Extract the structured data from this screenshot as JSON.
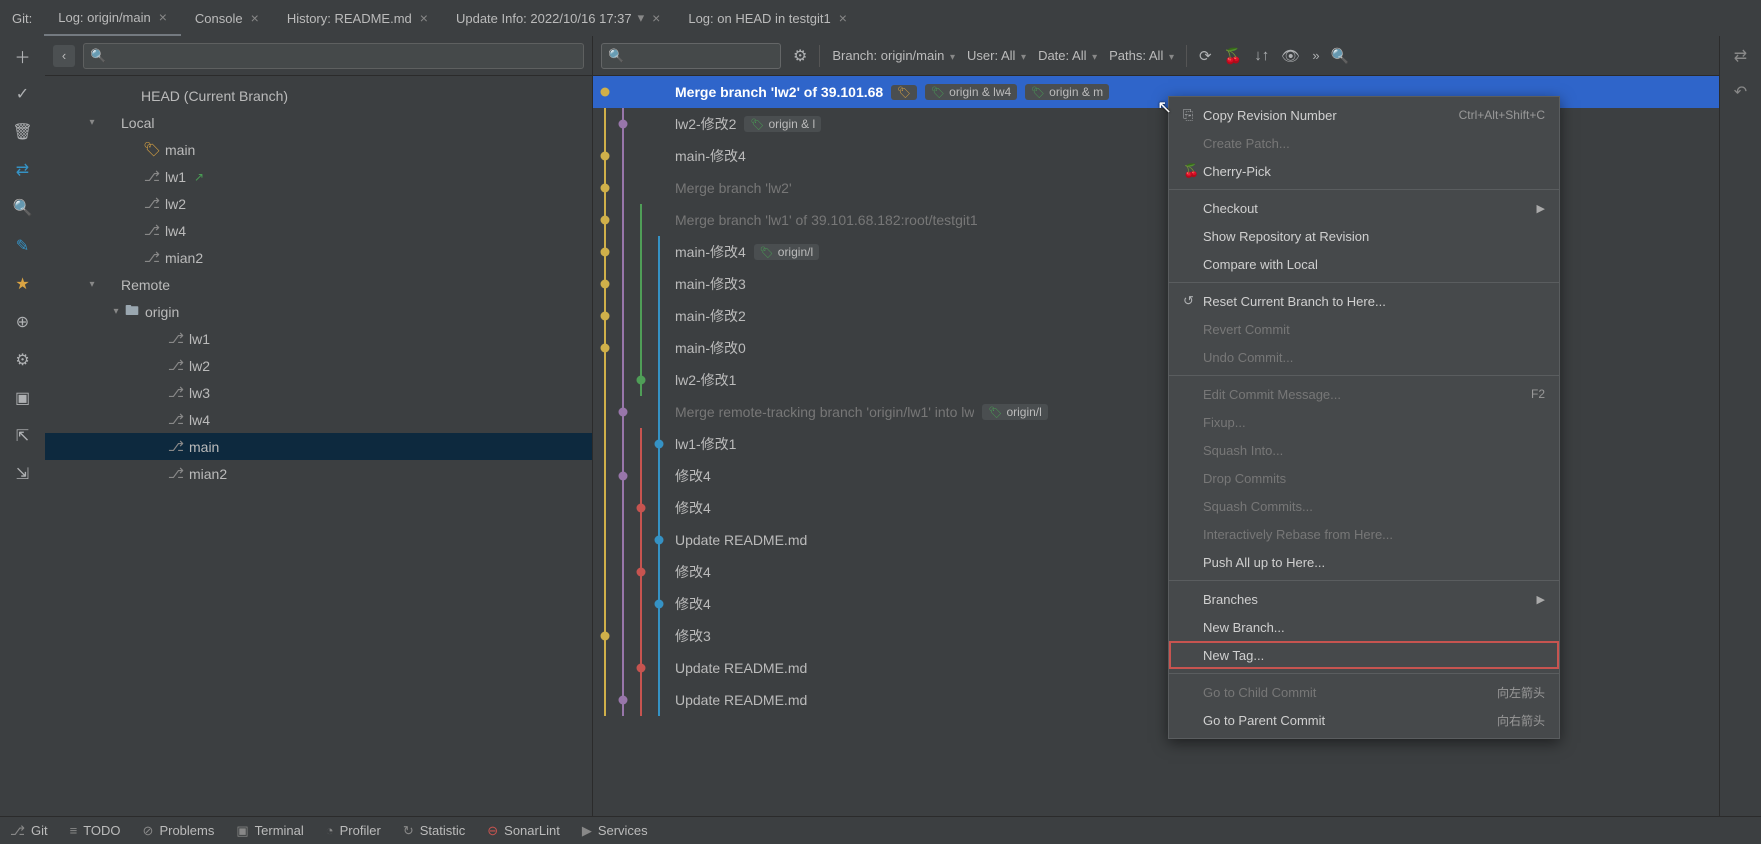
{
  "gitLabel": "Git:",
  "tabs": [
    {
      "label": "Log: origin/main",
      "close": true,
      "active": true
    },
    {
      "label": "Console",
      "close": true
    },
    {
      "label": "History: README.md",
      "close": true
    },
    {
      "label": "Update Info: 2022/10/16 17:37",
      "close": true,
      "chev": true
    },
    {
      "label": "Log: on HEAD in testgit1",
      "close": true
    }
  ],
  "tree": {
    "head": "HEAD (Current Branch)",
    "local": "Local",
    "remote": "Remote",
    "origin": "origin",
    "localBranches": [
      {
        "name": "main",
        "icon": "tag"
      },
      {
        "name": "lw1",
        "icon": "branch",
        "out": true
      },
      {
        "name": "lw2",
        "icon": "branch"
      },
      {
        "name": "lw4",
        "icon": "branch"
      },
      {
        "name": "mian2",
        "icon": "branch"
      }
    ],
    "remoteBranches": [
      {
        "name": "lw1"
      },
      {
        "name": "lw2"
      },
      {
        "name": "lw3"
      },
      {
        "name": "lw4"
      },
      {
        "name": "main",
        "selected": true
      },
      {
        "name": "mian2"
      }
    ]
  },
  "filters": {
    "branch": "Branch: origin/main",
    "user": "User: All",
    "date": "Date: All",
    "paths": "Paths: All"
  },
  "commits": [
    {
      "msg": "Merge branch 'lw2' of 39.101.68",
      "sel": true,
      "nodes": [
        {
          "x": 12,
          "c": "c-yel"
        }
      ],
      "lines": [],
      "refs": [
        {
          "t": "origin & lw4",
          "ic": "t-green"
        },
        {
          "t": "origin & m",
          "ic": "t-green"
        }
      ],
      "extraTag": true
    },
    {
      "msg": "lw2-修改2",
      "nodes": [
        {
          "x": 30,
          "c": "c-pur"
        }
      ],
      "lines": [
        {
          "x": 12,
          "c": "c-yel"
        },
        {
          "x": 30,
          "c": "c-pur"
        }
      ],
      "refs": [
        {
          "t": "origin & l",
          "ic": "t-green"
        }
      ]
    },
    {
      "msg": "main-修改4",
      "nodes": [
        {
          "x": 12,
          "c": "c-yel"
        }
      ],
      "lines": [
        {
          "x": 12,
          "c": "c-yel"
        },
        {
          "x": 30,
          "c": "c-pur"
        }
      ]
    },
    {
      "msg": "Merge branch 'lw2'",
      "dim": true,
      "nodes": [
        {
          "x": 12,
          "c": "c-yel"
        }
      ],
      "lines": [
        {
          "x": 12,
          "c": "c-yel"
        },
        {
          "x": 30,
          "c": "c-pur"
        }
      ]
    },
    {
      "msg": "Merge branch 'lw1' of 39.101.68.182:root/testgit1",
      "dim": true,
      "nodes": [
        {
          "x": 12,
          "c": "c-yel"
        }
      ],
      "lines": [
        {
          "x": 12,
          "c": "c-yel"
        },
        {
          "x": 30,
          "c": "c-pur"
        },
        {
          "x": 48,
          "c": "c-grn"
        }
      ]
    },
    {
      "msg": "main-修改4",
      "nodes": [
        {
          "x": 12,
          "c": "c-yel"
        }
      ],
      "lines": [
        {
          "x": 12,
          "c": "c-yel"
        },
        {
          "x": 30,
          "c": "c-pur"
        },
        {
          "x": 48,
          "c": "c-grn"
        },
        {
          "x": 66,
          "c": "c-blu"
        }
      ],
      "refs": [
        {
          "t": "origin/l",
          "ic": "t-green"
        }
      ]
    },
    {
      "msg": "main-修改3",
      "nodes": [
        {
          "x": 12,
          "c": "c-yel"
        }
      ],
      "lines": [
        {
          "x": 12,
          "c": "c-yel"
        },
        {
          "x": 30,
          "c": "c-pur"
        },
        {
          "x": 48,
          "c": "c-grn"
        },
        {
          "x": 66,
          "c": "c-blu"
        }
      ]
    },
    {
      "msg": "main-修改2",
      "nodes": [
        {
          "x": 12,
          "c": "c-yel"
        }
      ],
      "lines": [
        {
          "x": 12,
          "c": "c-yel"
        },
        {
          "x": 30,
          "c": "c-pur"
        },
        {
          "x": 48,
          "c": "c-grn"
        },
        {
          "x": 66,
          "c": "c-blu"
        }
      ]
    },
    {
      "msg": "main-修改0",
      "nodes": [
        {
          "x": 12,
          "c": "c-yel"
        }
      ],
      "lines": [
        {
          "x": 12,
          "c": "c-yel"
        },
        {
          "x": 30,
          "c": "c-pur"
        },
        {
          "x": 48,
          "c": "c-grn"
        },
        {
          "x": 66,
          "c": "c-blu"
        }
      ]
    },
    {
      "msg": "lw2-修改1",
      "nodes": [
        {
          "x": 48,
          "c": "c-grn"
        }
      ],
      "lines": [
        {
          "x": 12,
          "c": "c-yel"
        },
        {
          "x": 30,
          "c": "c-pur"
        },
        {
          "x": 48,
          "c": "c-grn"
        },
        {
          "x": 66,
          "c": "c-blu"
        }
      ]
    },
    {
      "msg": "Merge remote-tracking branch 'origin/lw1' into lw",
      "dim": true,
      "nodes": [
        {
          "x": 30,
          "c": "c-pur"
        }
      ],
      "lines": [
        {
          "x": 12,
          "c": "c-yel"
        },
        {
          "x": 30,
          "c": "c-pur"
        },
        {
          "x": 66,
          "c": "c-blu"
        }
      ],
      "refs": [
        {
          "t": "origin/l",
          "ic": "t-green"
        }
      ]
    },
    {
      "msg": "lw1-修改1",
      "nodes": [
        {
          "x": 66,
          "c": "c-blu"
        }
      ],
      "lines": [
        {
          "x": 12,
          "c": "c-yel"
        },
        {
          "x": 30,
          "c": "c-pur"
        },
        {
          "x": 48,
          "c": "c-red"
        },
        {
          "x": 66,
          "c": "c-blu"
        }
      ]
    },
    {
      "msg": "修改4",
      "nodes": [
        {
          "x": 30,
          "c": "c-pur"
        }
      ],
      "lines": [
        {
          "x": 12,
          "c": "c-yel"
        },
        {
          "x": 30,
          "c": "c-pur"
        },
        {
          "x": 48,
          "c": "c-red"
        },
        {
          "x": 66,
          "c": "c-blu"
        }
      ]
    },
    {
      "msg": "修改4",
      "nodes": [
        {
          "x": 48,
          "c": "c-red"
        }
      ],
      "lines": [
        {
          "x": 12,
          "c": "c-yel"
        },
        {
          "x": 30,
          "c": "c-pur"
        },
        {
          "x": 48,
          "c": "c-red"
        },
        {
          "x": 66,
          "c": "c-blu"
        }
      ]
    },
    {
      "msg": "Update README.md",
      "nodes": [
        {
          "x": 66,
          "c": "c-blu"
        }
      ],
      "lines": [
        {
          "x": 12,
          "c": "c-yel"
        },
        {
          "x": 30,
          "c": "c-pur"
        },
        {
          "x": 48,
          "c": "c-red"
        },
        {
          "x": 66,
          "c": "c-blu"
        }
      ]
    },
    {
      "msg": "修改4",
      "nodes": [
        {
          "x": 48,
          "c": "c-red"
        }
      ],
      "lines": [
        {
          "x": 12,
          "c": "c-yel"
        },
        {
          "x": 30,
          "c": "c-pur"
        },
        {
          "x": 48,
          "c": "c-red"
        },
        {
          "x": 66,
          "c": "c-blu"
        }
      ]
    },
    {
      "msg": "修改4",
      "nodes": [
        {
          "x": 66,
          "c": "c-blu"
        }
      ],
      "lines": [
        {
          "x": 12,
          "c": "c-yel"
        },
        {
          "x": 30,
          "c": "c-pur"
        },
        {
          "x": 48,
          "c": "c-red"
        },
        {
          "x": 66,
          "c": "c-blu"
        }
      ]
    },
    {
      "msg": "修改3",
      "nodes": [
        {
          "x": 12,
          "c": "c-yel"
        }
      ],
      "lines": [
        {
          "x": 12,
          "c": "c-yel"
        },
        {
          "x": 30,
          "c": "c-pur"
        },
        {
          "x": 48,
          "c": "c-red"
        },
        {
          "x": 66,
          "c": "c-blu"
        }
      ]
    },
    {
      "msg": "Update README.md",
      "nodes": [
        {
          "x": 48,
          "c": "c-red"
        }
      ],
      "lines": [
        {
          "x": 12,
          "c": "c-yel"
        },
        {
          "x": 30,
          "c": "c-pur"
        },
        {
          "x": 48,
          "c": "c-red"
        },
        {
          "x": 66,
          "c": "c-blu"
        }
      ]
    },
    {
      "msg": "Update README.md",
      "nodes": [
        {
          "x": 30,
          "c": "c-pur"
        }
      ],
      "lines": [
        {
          "x": 12,
          "c": "c-yel"
        },
        {
          "x": 30,
          "c": "c-pur"
        },
        {
          "x": 48,
          "c": "c-red"
        },
        {
          "x": 66,
          "c": "c-blu"
        }
      ]
    }
  ],
  "contextMenu": [
    {
      "type": "item",
      "label": "Copy Revision Number",
      "icon": "⎘",
      "shortcut": "Ctrl+Alt+Shift+C"
    },
    {
      "type": "item",
      "label": "Create Patch...",
      "disabled": true
    },
    {
      "type": "item",
      "label": "Cherry-Pick",
      "icon": "🍒"
    },
    {
      "type": "sep"
    },
    {
      "type": "item",
      "label": "Checkout",
      "arrow": true
    },
    {
      "type": "item",
      "label": "Show Repository at Revision"
    },
    {
      "type": "item",
      "label": "Compare with Local"
    },
    {
      "type": "sep"
    },
    {
      "type": "item",
      "label": "Reset Current Branch to Here...",
      "icon": "↺"
    },
    {
      "type": "item",
      "label": "Revert Commit",
      "disabled": true
    },
    {
      "type": "item",
      "label": "Undo Commit...",
      "disabled": true
    },
    {
      "type": "sep"
    },
    {
      "type": "item",
      "label": "Edit Commit Message...",
      "disabled": true,
      "shortcut": "F2"
    },
    {
      "type": "item",
      "label": "Fixup...",
      "disabled": true
    },
    {
      "type": "item",
      "label": "Squash Into...",
      "disabled": true
    },
    {
      "type": "item",
      "label": "Drop Commits",
      "disabled": true
    },
    {
      "type": "item",
      "label": "Squash Commits...",
      "disabled": true
    },
    {
      "type": "item",
      "label": "Interactively Rebase from Here...",
      "disabled": true
    },
    {
      "type": "item",
      "label": "Push All up to Here..."
    },
    {
      "type": "sep"
    },
    {
      "type": "item",
      "label": "Branches",
      "arrow": true
    },
    {
      "type": "item",
      "label": "New Branch..."
    },
    {
      "type": "item",
      "label": "New Tag...",
      "boxed": true
    },
    {
      "type": "sep"
    },
    {
      "type": "item",
      "label": "Go to Child Commit",
      "disabled": true,
      "shortcut": "向左箭头"
    },
    {
      "type": "item",
      "label": "Go to Parent Commit",
      "shortcut": "向右箭头"
    }
  ],
  "bottom": [
    {
      "label": "Git",
      "icon": "⎇"
    },
    {
      "label": "TODO",
      "icon": "≡"
    },
    {
      "label": "Problems",
      "icon": "⊘"
    },
    {
      "label": "Terminal",
      "icon": "▣"
    },
    {
      "label": "Profiler",
      "icon": "◔"
    },
    {
      "label": "Statistic",
      "icon": "↻"
    },
    {
      "label": "SonarLint",
      "icon": "⊖",
      "red": true
    },
    {
      "label": "Services",
      "icon": "▶"
    }
  ]
}
